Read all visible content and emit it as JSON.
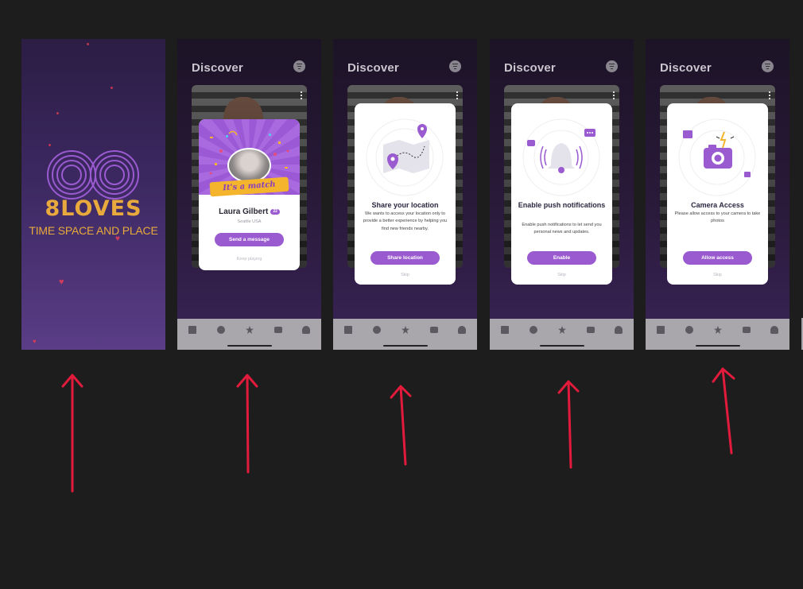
{
  "splash": {
    "brand": "8LOVES",
    "tagline": "TIME SPACE AND PLACE",
    "colors": {
      "brand": "#e8aa3c",
      "logo": "#9a5ad0"
    }
  },
  "discover": {
    "title": "Discover"
  },
  "match": {
    "ribbon": "It's a match",
    "name": "Laura Gilbert",
    "age": "22",
    "city": "Seattle USA",
    "button": "Send a message",
    "secondary": "Keep playing"
  },
  "location": {
    "title": "Share your location",
    "description": "We wants to access your location only to provide a better experience by helping you find new friends nearby.",
    "button": "Share location",
    "skip": "Skip"
  },
  "push": {
    "title": "Enable push notifications",
    "description": "Enable push notifications to let send you personal news and updates.",
    "button": "Enable",
    "skip": "Skip"
  },
  "camera": {
    "title": "Camera Access",
    "description": "Please allow access to your camera to take photos",
    "button": "Allow access",
    "skip": "Skip"
  },
  "tabbar": [
    "cards-icon",
    "compass-icon",
    "star-icon",
    "chat-icon",
    "profile-icon"
  ],
  "accent": "#9a5ad0",
  "annotation_color": "#e21b3c"
}
